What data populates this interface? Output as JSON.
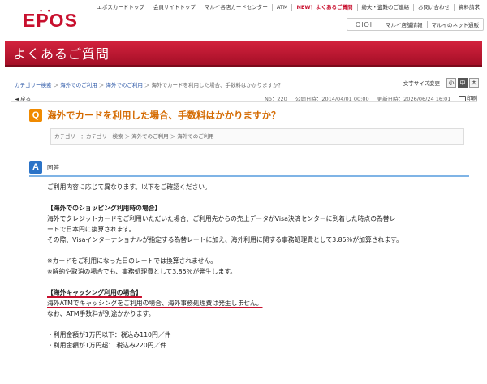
{
  "header": {
    "logo": "EPOS",
    "logo_accent": "#c8102e",
    "top_nav": [
      "エポスカードトップ",
      "会員サイトトップ",
      "マルイ各店カードセンター",
      "ATM",
      "NEW！よくあるご質問",
      "紛失・盗難のご連絡",
      "お問い合わせ",
      "資料請求"
    ],
    "sub_nav": {
      "logo": "OIOI",
      "items": [
        "マルイ店舗情報",
        "マルイのネット通販"
      ]
    }
  },
  "banner": {
    "title": "よくあるご質問"
  },
  "breadcrumb": {
    "items": [
      "カテゴリー検索",
      "海外でのご利用",
      "海外でのご利用",
      "海外でカードを利用した場合、手数料はかかりますか？"
    ],
    "sep": "＞"
  },
  "font_size": {
    "label": "文字サイズ変更",
    "options": [
      "小",
      "中",
      "大"
    ],
    "selected": "中"
  },
  "back": {
    "label": "戻る"
  },
  "meta": {
    "number": "No：220",
    "published": "公開日時：2014/04/01 00:00",
    "updated": "更新日時：2026/06/24 16:01"
  },
  "print": {
    "label": "印刷"
  },
  "question": {
    "badge": "Q",
    "title": "海外でカードを利用した場合、手数料はかかりますか？"
  },
  "category": {
    "text": "カテゴリー：カテゴリー検索 ＞ 海外でのご利用 ＞ 海外でのご利用"
  },
  "answer": {
    "badge": "A",
    "label": "回答",
    "intro": "ご利用内容に応じて異なります。以下をご確認ください。",
    "shopping_heading": "【海外でのショッピング利用時の場合】",
    "shopping_line1": "海外でクレジットカードをご利用いただいた場合、ご利用先からの売上データがVisa決済センターに到着した時点の為替レ",
    "shopping_line2": "ートで日本円に換算されます。",
    "shopping_line3": "その際、Visaインターナショナルが指定する為替レートに加え、海外利用に関する事務処理費として3.85％が加算されます。",
    "note1": "※カードをご利用になった日のレートでは換算されません。",
    "note2": "※解約や取消の場合でも、事務処理費として3.85％が発生します。",
    "cashing_heading": "【海外キャッシング利用の場合】",
    "cashing_line1": "海外ATMでキャッシングをご利用の場合、海外事務処理費は発生しません。",
    "cashing_line2": "なお、ATM手数料が別途かかります。",
    "fee1": "・利用金額が1万円以下：税込み110円／件",
    "fee2": "・利用金額が1万円超： 税込み220円／件"
  }
}
